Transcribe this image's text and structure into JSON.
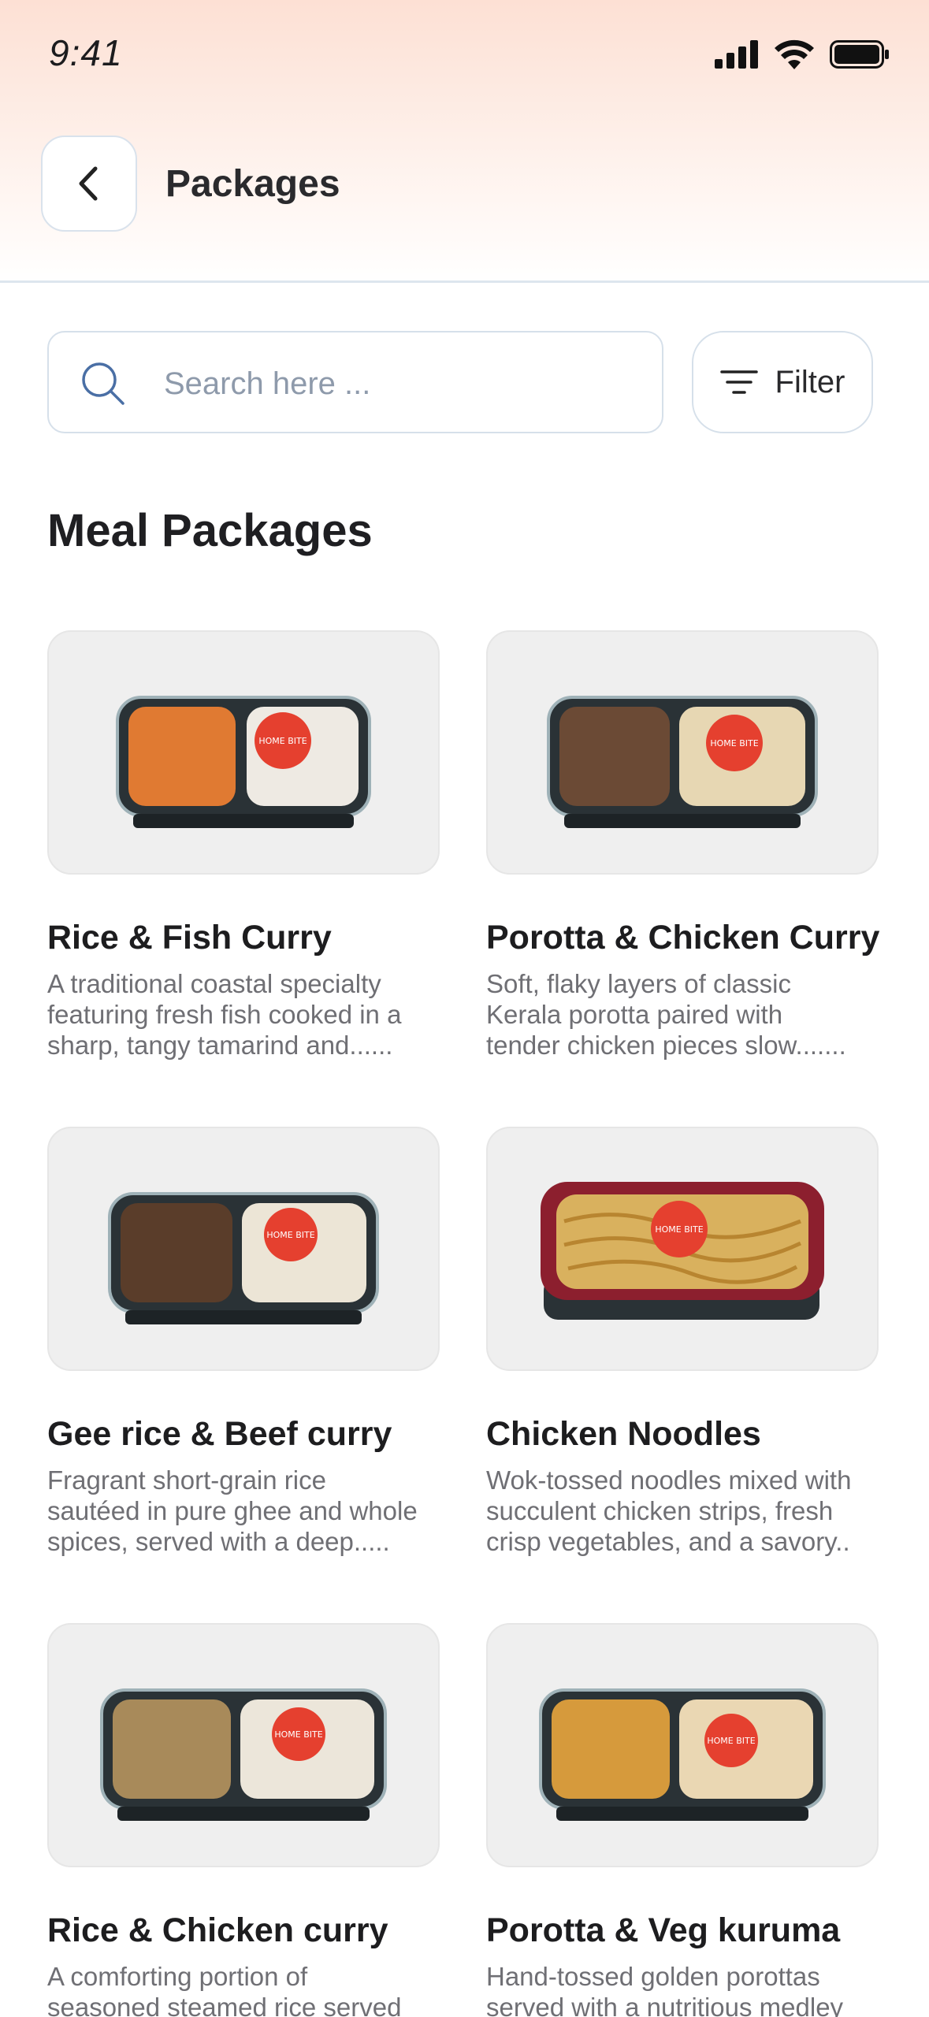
{
  "status_bar": {
    "time": "9:41"
  },
  "header": {
    "title": "Packages"
  },
  "search": {
    "placeholder": "Search here ..."
  },
  "filter": {
    "label": "Filter"
  },
  "section": {
    "title": "Meal Packages"
  },
  "packages": [
    {
      "name": "Rice & Fish Curry",
      "description": " A traditional coastal specialty\nfeaturing fresh fish cooked in a\nsharp, tangy tamarind and......",
      "image_icon": "meal-box-image",
      "badge": "HOME BITE"
    },
    {
      "name": "Porotta & Chicken Curry",
      "description": " Soft, flaky layers of classic\nKerala porotta paired with\ntender chicken pieces slow.......",
      "image_icon": "meal-box-image",
      "badge": "HOME BITE"
    },
    {
      "name": "Gee rice & Beef curry",
      "description": "Fragrant short-grain rice\nsautéed in pure ghee and whole\nspices, served with a deep.....",
      "image_icon": "meal-box-image",
      "badge": "HOME BITE"
    },
    {
      "name": "Chicken Noodles",
      "description": "Wok-tossed noodles mixed with\nsucculent chicken strips, fresh\ncrisp vegetables, and a savory..",
      "image_icon": "noodle-box-image",
      "badge": "HOME BITE"
    },
    {
      "name": "Rice & Chicken curry",
      "description": "A comforting portion of\nseasoned steamed rice served",
      "image_icon": "meal-box-image",
      "badge": "HOME BITE"
    },
    {
      "name": "Porotta & Veg kuruma",
      "description": "Hand-tossed golden porottas\nserved with a nutritious medley",
      "image_icon": "meal-box-image",
      "badge": "HOME BITE"
    }
  ],
  "colors": {
    "accent_badge": "#e5402f",
    "card_bg": "#efefef",
    "border": "#d6e0ea",
    "header_gradient": "#fde0d4"
  }
}
